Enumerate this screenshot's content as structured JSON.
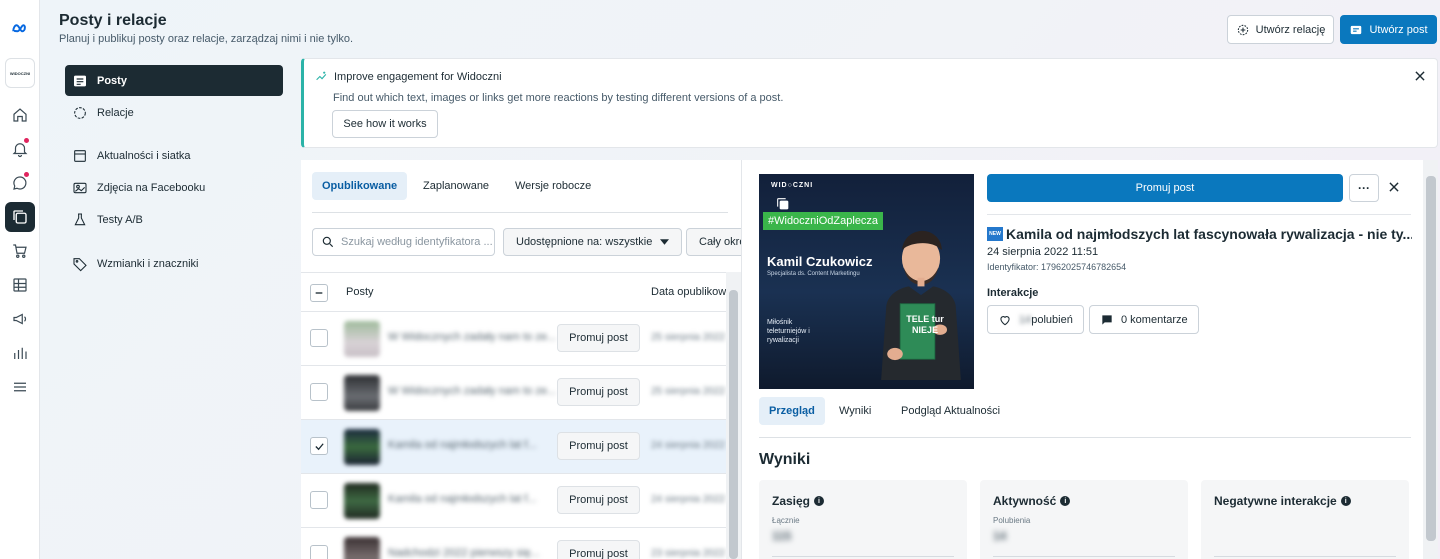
{
  "header": {
    "title": "Posty i relacje",
    "subtitle": "Planuj i publikuj posty oraz relacje, zarządzaj nimi i nie tylko.",
    "create_story_label": "Utwórz relację",
    "create_post_label": "Utwórz post"
  },
  "rail": {
    "brand_label": "WIDOCZNI"
  },
  "sidebar": {
    "items": [
      {
        "label": "Posty"
      },
      {
        "label": "Relacje"
      },
      {
        "label": "Aktualności i siatka"
      },
      {
        "label": "Zdjęcia na Facebooku"
      },
      {
        "label": "Testy A/B"
      },
      {
        "label": "Wzmianki i znaczniki"
      }
    ]
  },
  "banner": {
    "title": "Improve engagement for Widoczni",
    "text": "Find out which text, images or links get more reactions by testing different versions of a post.",
    "button_label": "See how it works"
  },
  "list": {
    "tabs": [
      {
        "label": "Opublikowane"
      },
      {
        "label": "Zaplanowane"
      },
      {
        "label": "Wersje robocze"
      }
    ],
    "search_placeholder": "Szukaj według identyfikatora ...",
    "filter_shared": "Udostępnione na: wszystkie",
    "filter_period": "Cały okres",
    "columns": {
      "posts": "Posty",
      "date": "Data opublikowania"
    },
    "rows": [
      {
        "title": "W Widocznych zadały nam to ze...",
        "button": "Promuj post",
        "date": "25 sierpnia 2022 11:00",
        "selected": false
      },
      {
        "title": "W Widocznych zadały nam to ze...",
        "button": "Promuj post",
        "date": "25 sierpnia 2022 10:00",
        "selected": false
      },
      {
        "title": "Kamila od najmłodszych lat f...",
        "button": "Promuj post",
        "date": "24 sierpnia 2022 11:51",
        "selected": true
      },
      {
        "title": "Kamila od najmłodszych lat f...",
        "button": "Promuj post",
        "date": "24 sierpnia 2022 11:00",
        "selected": false
      },
      {
        "title": "Nadchodzi 2022 pierwszy się...",
        "button": "Promuj post",
        "date": "23 sierpnia 2022 10:00",
        "selected": false
      }
    ]
  },
  "detail": {
    "image": {
      "logo": "WID○CZNI",
      "hashtag": "#WidoczniOdZaplecza",
      "name": "Kamil Czukowicz",
      "role": "Specjalista ds. Content Marketingu",
      "tagline": "Miłośnik teleturniejów i rywalizacji",
      "book_text": "TELE tur NIEJE"
    },
    "promote_label": "Promuj post",
    "more_label": "···",
    "title": "Kamila od najmłodszych lat fascynowała rywalizacja - nie ty...",
    "badge": "NEW",
    "date": "24 sierpnia 2022 11:51",
    "id": "Identyfikator: 17962025746782654",
    "interactions_label": "Interakcje",
    "likes_count": "14",
    "likes_label": "polubień",
    "comments_label": "0 komentarze",
    "tabs": [
      {
        "label": "Przegląd"
      },
      {
        "label": "Wyniki"
      },
      {
        "label": "Podgląd Aktualności"
      }
    ],
    "results_title": "Wyniki",
    "cards": [
      {
        "title": "Zasięg",
        "sub": "Łącznie",
        "value": "115"
      },
      {
        "title": "Aktywność",
        "sub": "Polubienia",
        "value": "14"
      },
      {
        "title": "Negatywne interakcje",
        "sub": "",
        "value": ""
      }
    ]
  },
  "colors": {
    "primary": "#0a78be",
    "dark": "#1c2b33",
    "accent_teal": "#2bb3a8",
    "hashtag_green": "#3ab54a"
  }
}
